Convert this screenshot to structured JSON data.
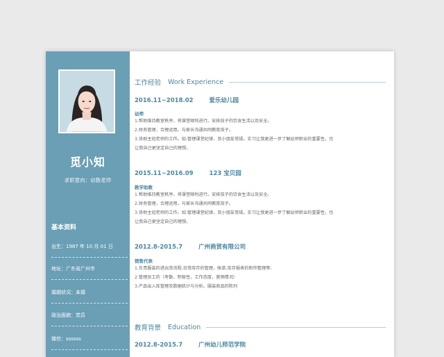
{
  "profile": {
    "name": "觅小知",
    "intent": "求职意向：幼教老师"
  },
  "basic_info": {
    "title": "基本资料",
    "items": [
      "出生：1987 年 10 月 01 日",
      "地址：广东省广州市",
      "婚姻状况：未婚",
      "政治面貌：党员",
      "微信：ssssss"
    ]
  },
  "work": {
    "title_cn": "工作经验",
    "title_en": "Work Experience",
    "jobs": [
      {
        "period": "2016.11~2018.02",
        "org": "爱乐幼儿园",
        "role": "幼师",
        "lines": [
          "1.帮助维持教室秩序，将课堂顺利进行。安排孩子的饮食生活以及安全。",
          "2.财务管理，合理运用。与家长沟通共同教育孩子。",
          "3.协助主班老师的工作。如:管理课堂纪律，及小朋友常规。实习让我更进一步了解幼师职业的重要性，也",
          "让我自己更坚定自己的理想。"
        ]
      },
      {
        "period": "2015.11~2016.09",
        "org": "123 宝贝园",
        "role": "教学助教",
        "lines": [
          "1.帮助维持教室秩序，将课堂顺利进行。安排孩子的饮食生活以及安全。",
          "2.财务管理，合理运用。与家长沟通共同教育孩子。",
          "3.协助主班老师的工作。如:管理课堂纪律，及小朋友常规。实习让我更进一步了解幼师职业的重要性，也",
          "让我自己更坚定自己的理想。"
        ]
      },
      {
        "period": "2012.8-2015.7",
        "org": "广州商贸有限公司",
        "role": "销售代表",
        "lines": [
          "1.负责服装的进出货流程,日常库存的管理，帐单,库存报表的制作整理等;",
          "2.管理员工的（考勤，积极性，工作态度，营销情况）",
          "3.产品出入库管理及数据统计与分析。服装商品的陈列"
        ]
      }
    ]
  },
  "education": {
    "title_cn": "教育背景",
    "title_en": "Education",
    "entries": [
      {
        "period": "2012.8-2015.7",
        "org": "广州幼儿师范学院"
      }
    ]
  },
  "colors": {
    "sidebar": "#6a9fb5",
    "accent": "#4c86a1",
    "body_text": "#666666"
  }
}
